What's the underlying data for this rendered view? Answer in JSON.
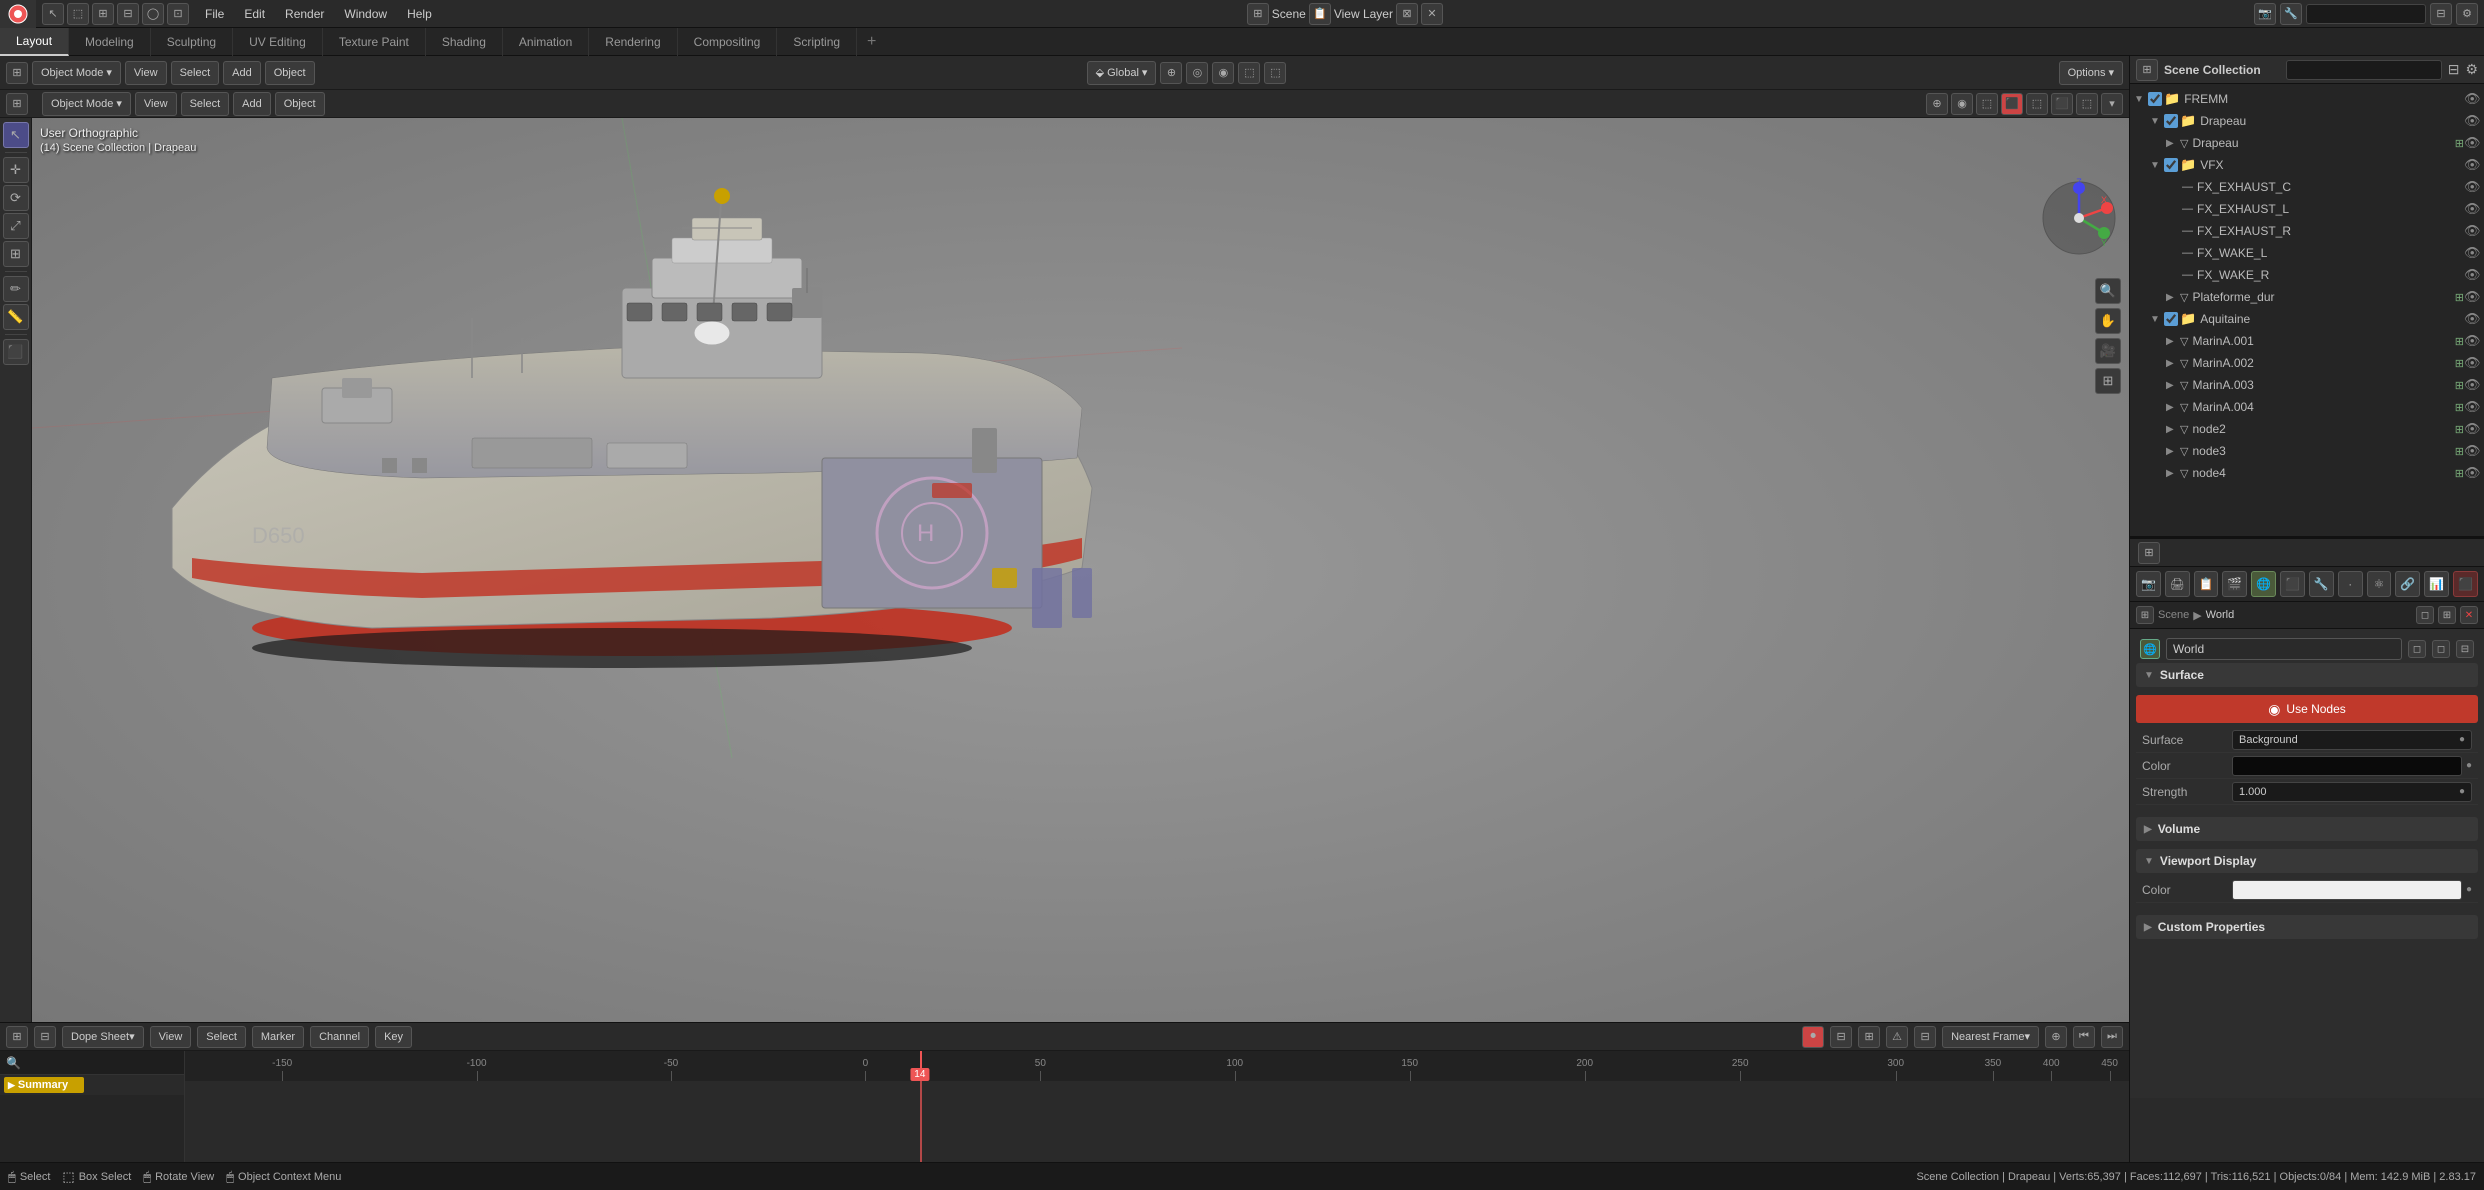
{
  "app": {
    "title": "Blender",
    "layout_active": true
  },
  "top_menu": {
    "items": [
      "Blender",
      "File",
      "Edit",
      "Render",
      "Window",
      "Help"
    ]
  },
  "workspace_tabs": {
    "tabs": [
      "Layout",
      "Modeling",
      "Sculpting",
      "UV Editing",
      "Texture Paint",
      "Shading",
      "Animation",
      "Rendering",
      "Compositing",
      "Scripting"
    ],
    "active": "Layout",
    "add_label": "+"
  },
  "viewport": {
    "mode_label": "Object Mode",
    "view_label": "View",
    "select_label": "Select",
    "add_label": "Add",
    "object_label": "Object",
    "options_label": "Options",
    "coord_label": "Global",
    "transform_label": "⇧",
    "snap_label": "⌀",
    "proportional_label": "◎",
    "viewport_label": "User Orthographic",
    "collection_label": "(14) Scene Collection | Drapeau",
    "gizmo_colors": {
      "x": "#e44",
      "y": "#4a4",
      "z": "#44e",
      "center": "#fff"
    }
  },
  "viewport_shading": {
    "icons": [
      "🔵",
      "⬛",
      "🔴",
      "◻",
      "◼",
      "🎨"
    ]
  },
  "outliner": {
    "title": "Scene Collection",
    "search_placeholder": "",
    "items": [
      {
        "indent": 0,
        "arrow": "▼",
        "icon": "📁",
        "color": "#5b9ed6",
        "label": "FREMM",
        "has_eye": true
      },
      {
        "indent": 1,
        "arrow": "▼",
        "icon": "📁",
        "color": "#5b9ed6",
        "label": "Drapeau",
        "has_eye": true,
        "checked": true
      },
      {
        "indent": 2,
        "arrow": "▶",
        "icon": "▽",
        "color": "#aaa",
        "label": "Drapeau",
        "has_eye": true
      },
      {
        "indent": 1,
        "arrow": "▼",
        "icon": "📁",
        "color": "#5b9ed6",
        "label": "VFX",
        "has_eye": true,
        "checked": true
      },
      {
        "indent": 2,
        "arrow": "",
        "icon": "—",
        "color": "#aaa",
        "label": "FX_EXHAUST_C",
        "has_eye": true
      },
      {
        "indent": 2,
        "arrow": "",
        "icon": "—",
        "color": "#aaa",
        "label": "FX_EXHAUST_L",
        "has_eye": true
      },
      {
        "indent": 2,
        "arrow": "",
        "icon": "—",
        "color": "#aaa",
        "label": "FX_EXHAUST_R",
        "has_eye": true
      },
      {
        "indent": 2,
        "arrow": "",
        "icon": "—",
        "color": "#aaa",
        "label": "FX_WAKE_L",
        "has_eye": true
      },
      {
        "indent": 2,
        "arrow": "",
        "icon": "—",
        "color": "#aaa",
        "label": "FX_WAKE_R",
        "has_eye": true
      },
      {
        "indent": 2,
        "arrow": "▶",
        "icon": "▽",
        "color": "#aaa",
        "label": "Plateforme_dur",
        "has_eye": true
      },
      {
        "indent": 1,
        "arrow": "▼",
        "icon": "📁",
        "color": "#5b9ed6",
        "label": "Aquitaine",
        "has_eye": true,
        "checked": true
      },
      {
        "indent": 2,
        "arrow": "▶",
        "icon": "▽",
        "color": "#aaa",
        "label": "MarinA.001",
        "has_eye": true
      },
      {
        "indent": 2,
        "arrow": "▶",
        "icon": "▽",
        "color": "#aaa",
        "label": "MarinA.002",
        "has_eye": true
      },
      {
        "indent": 2,
        "arrow": "▶",
        "icon": "▽",
        "color": "#aaa",
        "label": "MarinA.003",
        "has_eye": true
      },
      {
        "indent": 2,
        "arrow": "▶",
        "icon": "▽",
        "color": "#aaa",
        "label": "MarinA.004",
        "has_eye": true
      },
      {
        "indent": 2,
        "arrow": "▶",
        "icon": "▽",
        "color": "#aaa",
        "label": "node2",
        "has_eye": true
      },
      {
        "indent": 2,
        "arrow": "▶",
        "icon": "▽",
        "color": "#aaa",
        "label": "node3",
        "has_eye": true
      },
      {
        "indent": 2,
        "arrow": "▶",
        "icon": "▽",
        "color": "#aaa",
        "label": "node4",
        "has_eye": true
      }
    ]
  },
  "properties": {
    "nav_scene": "Scene",
    "nav_arrow": "▶",
    "nav_world": "World",
    "world_label": "World",
    "surface_label": "Surface",
    "use_nodes_label": "Use Nodes",
    "surface_type_label": "Surface",
    "surface_type_value": "Background",
    "color_label": "Color",
    "strength_label": "Strength",
    "strength_value": "1.000",
    "volume_label": "Volume",
    "viewport_display_label": "Viewport Display",
    "viewport_color_label": "Color",
    "custom_properties_label": "Custom Properties",
    "prop_icons": [
      "🎬",
      "📷",
      "🌐",
      "💡",
      "🔵",
      "🔧",
      "📊",
      "🎭",
      "🔲",
      "⬛",
      "📐"
    ]
  },
  "timeline": {
    "editor_label": "Dope Sheet",
    "view_label": "View",
    "select_label": "Select",
    "marker_label": "Marker",
    "channel_label": "Channel",
    "key_label": "Key",
    "nearest_frame_label": "Nearest Frame",
    "summary_label": "Summary",
    "current_frame": "14",
    "ticks": [
      -150,
      -100,
      -50,
      0,
      50,
      100,
      150,
      200,
      250,
      300,
      350,
      400,
      450
    ]
  },
  "status_bar": {
    "select_label": "Select",
    "box_select_label": "Box Select",
    "rotate_view_label": "Rotate View",
    "object_context_label": "Object Context Menu",
    "stats": "Scene Collection | Drapeau | Verts:65,397 | Faces:112,697 | Tris:116,521 | Objects:0/84 | Mem: 142.9 MiB | 2.83.17"
  },
  "left_toolbar": {
    "tools": [
      "↖",
      "↔",
      "↕",
      "⟳",
      "⟲",
      "◻",
      "✏",
      "🔄",
      "📏",
      "🔵",
      "⬛",
      "🔘"
    ]
  }
}
